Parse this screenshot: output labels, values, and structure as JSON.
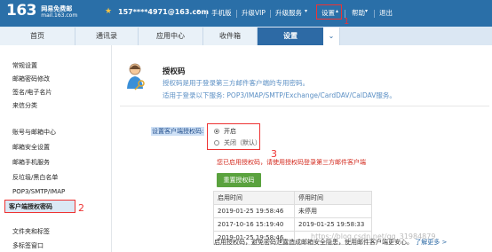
{
  "header": {
    "logo_number": "163",
    "logo_name": "网易免费邮",
    "logo_domain": "mail.163.com",
    "user_email": "157****4971@163.com",
    "links": {
      "mobile": "手机版",
      "vip": "升级VIP",
      "upgrade": "升级服务",
      "settings": "设置",
      "help": "帮助",
      "logout": "退出"
    },
    "annotation_1": "1"
  },
  "nav": {
    "tabs": [
      "首页",
      "通讯录",
      "应用中心",
      "收件箱",
      "设置"
    ],
    "more_icon": "chevron-down-icon"
  },
  "sidebar": {
    "items": [
      "常规设置",
      "邮箱密码修改",
      "签名/电子名片",
      "来信分类",
      "账号与邮箱中心",
      "邮箱安全设置",
      "邮箱手机服务",
      "反垃圾/黑白名单",
      "POP3/SMTP/IMAP",
      "客户端授权密码",
      "文件夹和标签",
      "多标签窗口"
    ],
    "active_index": 9,
    "annotation_2": "2"
  },
  "content": {
    "title": "授权码",
    "desc1": "授权码是用于登录第三方邮件客户端的专用密码。",
    "desc2": "适用于登录以下服务: POP3/IMAP/SMTP/Exchange/CardDAV/CalDAV服务。",
    "setting_label": "设置客户端授权码:",
    "radio_on": "开启",
    "radio_off": "关闭（默认）",
    "annotation_3": "3",
    "warning": "您已启用授权码，请使用授权码登录第三方邮件客户端",
    "reset_button": "重置授权码",
    "table": {
      "headers": [
        "启用时间",
        "停用时间"
      ],
      "rows": [
        [
          "2019-01-25 19:58:46",
          "未停用"
        ],
        [
          "2017-10-16 15:19:40",
          "2019-01-25 19:58:33"
        ],
        [
          "2019-01-25 19:58:46",
          ""
        ]
      ]
    },
    "footer_text": "启用授权码，避免密码泄露造成邮箱安全隐患，使用邮件客户端更安心。",
    "footer_link": "了解更多 >",
    "watermark": "https://blog.csdn.net/qq_31984879"
  }
}
